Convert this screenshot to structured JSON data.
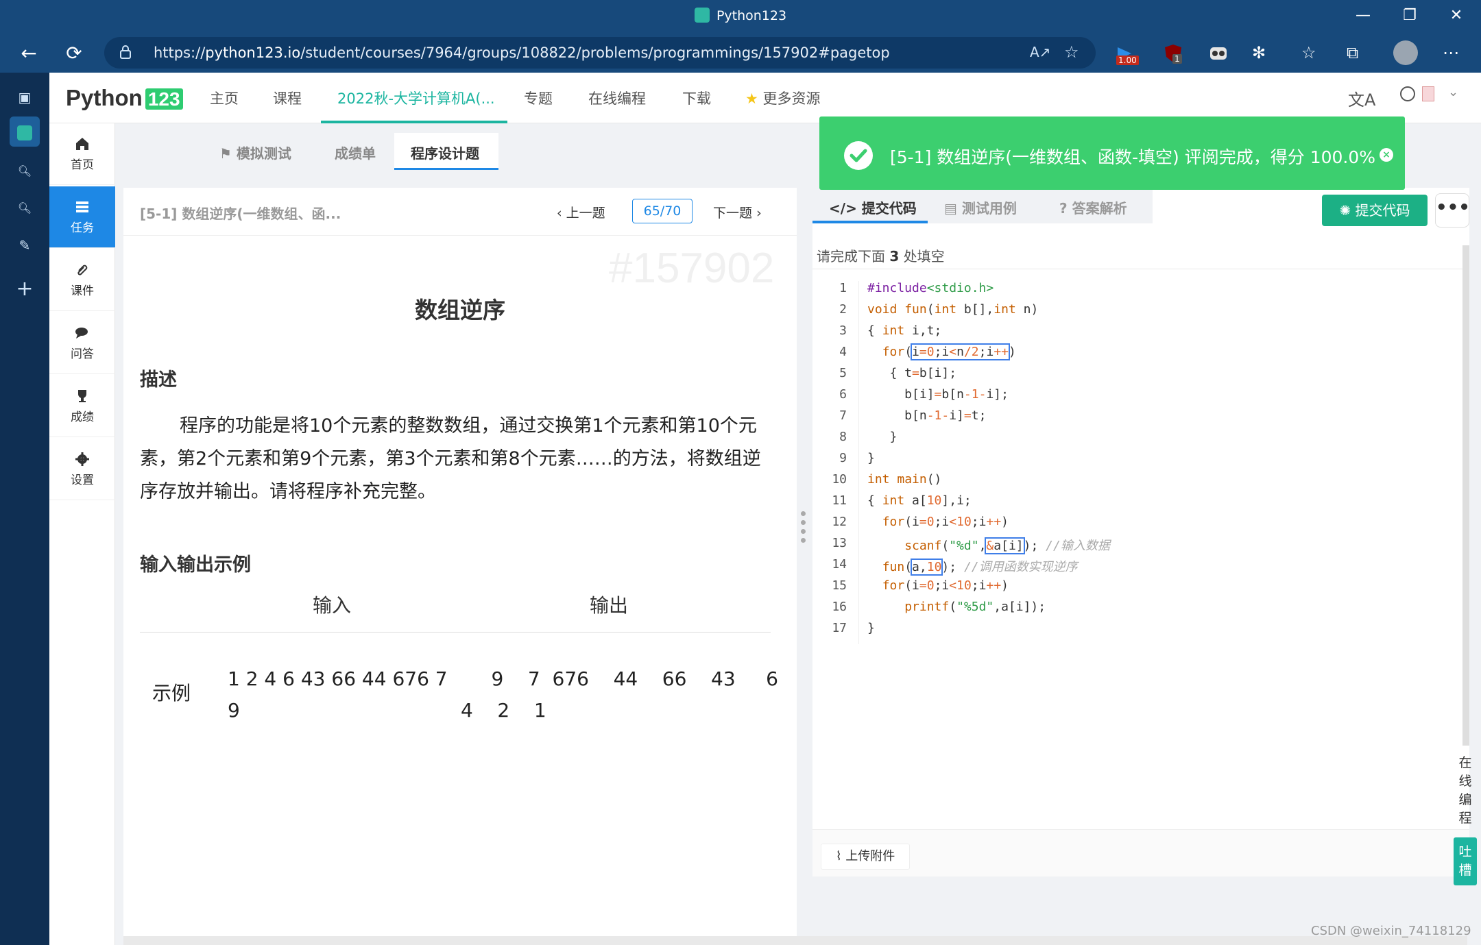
{
  "window": {
    "title": "Python123"
  },
  "browser": {
    "url_prefix": "https://",
    "url_host": "python123.io",
    "url_path": "/student/courses/7964/groups/108822/problems/programmings/157902#pagetop",
    "ext_badge_1": "1.00",
    "ext_badge_2": "1"
  },
  "app": {
    "logo_text": "Python",
    "logo_num": "123",
    "nav": [
      "主页",
      "课程",
      "2022秋-大学计算机A(...",
      "专题",
      "在线编程",
      "下载",
      "更多资源"
    ],
    "side_menu": [
      "首页",
      "任务",
      "课件",
      "问答",
      "成绩",
      "设置"
    ],
    "sub_tabs": [
      "模拟测试",
      "成绩单",
      "程序设计题"
    ]
  },
  "problem": {
    "header_title": "[5-1] 数组逆序(一维数组、函...",
    "prev": "上一题",
    "page": "65/70",
    "next": "下一题",
    "watermark": "#157902",
    "title": "数组逆序",
    "desc_heading": "描述",
    "description": "程序的功能是将10个元素的整数数组，通过交换第1个元素和第10个元素，第2个元素和第9个元素，第3个元素和第8个元素……的方法，将数组逆序存放并输出。请将程序补充完整。",
    "io_heading": "输入输出示例",
    "col_input": "输入",
    "col_output": "输出",
    "row_label": "示例",
    "example_input": "1 2 4 6 43 66 44 676 7\n9",
    "example_output": "     9    7  676    44    66    43     6\n4    2    1"
  },
  "code_panel": {
    "tabs": [
      "提交代码",
      "测试用例",
      "答案解析"
    ],
    "submit_label": "提交代码",
    "more_label": "•••",
    "hint_prefix": "请完成下面 ",
    "hint_count": "3",
    "hint_suffix": " 处填空",
    "line_numbers": [
      "1",
      "2",
      "3",
      "4",
      "5",
      "6",
      "7",
      "8",
      "9",
      "10",
      "11",
      "12",
      "13",
      "14",
      "15",
      "16",
      "17"
    ],
    "upload_label": "上传附件"
  },
  "toast": {
    "message": "[5-1] 数组逆序(一维数组、函数-填空) 评阅完成，得分 100.0%"
  },
  "floating": {
    "online": "在线编程",
    "roast": "吐槽"
  },
  "credit": "CSDN @weixin_74118129",
  "colors": {
    "accent": "#1e88e5",
    "brand": "#1cb5a0",
    "success": "#3ccf6f"
  }
}
